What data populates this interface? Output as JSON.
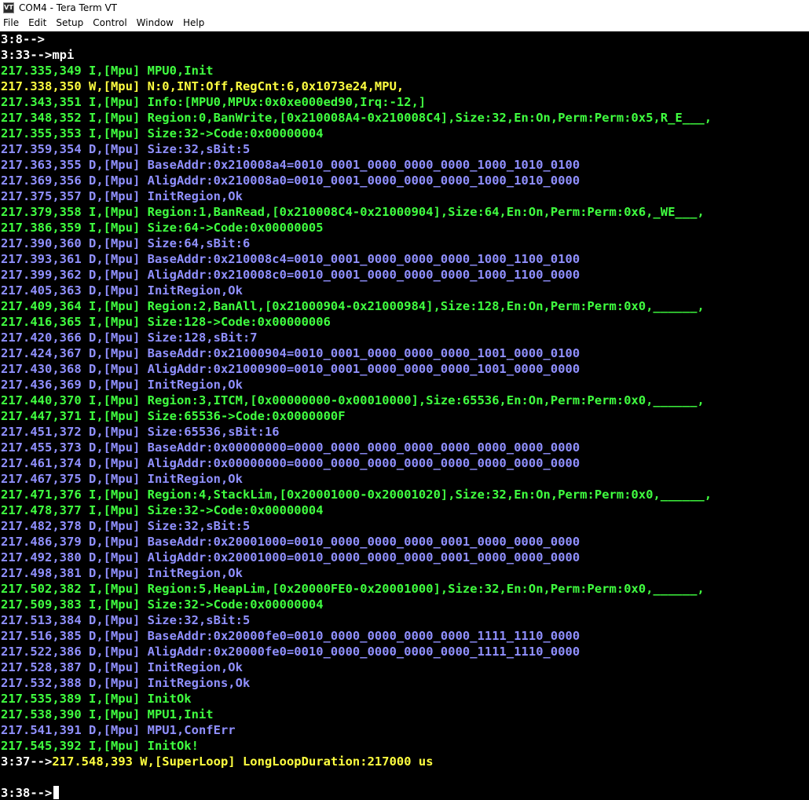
{
  "window": {
    "title": "COM4 - Tera Term VT",
    "icon_text": "VT"
  },
  "menu": {
    "items": [
      "File",
      "Edit",
      "Setup",
      "Control",
      "Window",
      "Help"
    ]
  },
  "colors": {
    "white": "#ffffff",
    "green": "#40ff40",
    "yellow": "#ffff40",
    "blue": "#9090ff"
  },
  "terminal": {
    "lines": [
      [
        {
          "t": "3:8-->",
          "c": "white"
        }
      ],
      [
        {
          "t": "3:33-->mpi",
          "c": "white"
        }
      ],
      [
        {
          "t": "217.335,349 I,[Mpu] MPU0,Init",
          "c": "green"
        }
      ],
      [
        {
          "t": "217.338,350 W,[Mpu] N:0,INT:Off,RegCnt:6,0x1073e24,MPU,",
          "c": "yellow"
        }
      ],
      [
        {
          "t": "217.343,351 I,[Mpu] Info:[MPU0,MPUx:0x0xe000ed90,Irq:-12,]",
          "c": "green"
        }
      ],
      [
        {
          "t": "217.348,352 I,[Mpu] Region:0,BanWrite,[0x210008A4-0x210008C4],Size:32,En:On,Perm:Perm:0x5,R_E___,",
          "c": "green"
        }
      ],
      [
        {
          "t": "217.355,353 I,[Mpu] Size:32->Code:0x00000004",
          "c": "green"
        }
      ],
      [
        {
          "t": "217.359,354 D,[Mpu] Size:32,sBit:5",
          "c": "blue"
        }
      ],
      [
        {
          "t": "217.363,355 D,[Mpu] BaseAddr:0x210008a4=0010_0001_0000_0000_0000_1000_1010_0100",
          "c": "blue"
        }
      ],
      [
        {
          "t": "217.369,356 D,[Mpu] AligAddr:0x210008a0=0010_0001_0000_0000_0000_1000_1010_0000",
          "c": "blue"
        }
      ],
      [
        {
          "t": "217.375,357 D,[Mpu] InitRegion,Ok",
          "c": "blue"
        }
      ],
      [
        {
          "t": "217.379,358 I,[Mpu] Region:1,BanRead,[0x210008C4-0x21000904],Size:64,En:On,Perm:Perm:0x6,_WE___,",
          "c": "green"
        }
      ],
      [
        {
          "t": "217.386,359 I,[Mpu] Size:64->Code:0x00000005",
          "c": "green"
        }
      ],
      [
        {
          "t": "217.390,360 D,[Mpu] Size:64,sBit:6",
          "c": "blue"
        }
      ],
      [
        {
          "t": "217.393,361 D,[Mpu] BaseAddr:0x210008c4=0010_0001_0000_0000_0000_1000_1100_0100",
          "c": "blue"
        }
      ],
      [
        {
          "t": "217.399,362 D,[Mpu] AligAddr:0x210008c0=0010_0001_0000_0000_0000_1000_1100_0000",
          "c": "blue"
        }
      ],
      [
        {
          "t": "217.405,363 D,[Mpu] InitRegion,Ok",
          "c": "blue"
        }
      ],
      [
        {
          "t": "217.409,364 I,[Mpu] Region:2,BanAll,[0x21000904-0x21000984],Size:128,En:On,Perm:Perm:0x0,______,",
          "c": "green"
        }
      ],
      [
        {
          "t": "217.416,365 I,[Mpu] Size:128->Code:0x00000006",
          "c": "green"
        }
      ],
      [
        {
          "t": "217.420,366 D,[Mpu] Size:128,sBit:7",
          "c": "blue"
        }
      ],
      [
        {
          "t": "217.424,367 D,[Mpu] BaseAddr:0x21000904=0010_0001_0000_0000_0000_1001_0000_0100",
          "c": "blue"
        }
      ],
      [
        {
          "t": "217.430,368 D,[Mpu] AligAddr:0x21000900=0010_0001_0000_0000_0000_1001_0000_0000",
          "c": "blue"
        }
      ],
      [
        {
          "t": "217.436,369 D,[Mpu] InitRegion,Ok",
          "c": "blue"
        }
      ],
      [
        {
          "t": "217.440,370 I,[Mpu] Region:3,ITCM,[0x00000000-0x00010000],Size:65536,En:On,Perm:Perm:0x0,______,",
          "c": "green"
        }
      ],
      [
        {
          "t": "217.447,371 I,[Mpu] Size:65536->Code:0x0000000F",
          "c": "green"
        }
      ],
      [
        {
          "t": "217.451,372 D,[Mpu] Size:65536,sBit:16",
          "c": "blue"
        }
      ],
      [
        {
          "t": "217.455,373 D,[Mpu] BaseAddr:0x00000000=0000_0000_0000_0000_0000_0000_0000_0000",
          "c": "blue"
        }
      ],
      [
        {
          "t": "217.461,374 D,[Mpu] AligAddr:0x00000000=0000_0000_0000_0000_0000_0000_0000_0000",
          "c": "blue"
        }
      ],
      [
        {
          "t": "217.467,375 D,[Mpu] InitRegion,Ok",
          "c": "blue"
        }
      ],
      [
        {
          "t": "217.471,376 I,[Mpu] Region:4,StackLim,[0x20001000-0x20001020],Size:32,En:On,Perm:Perm:0x0,______,",
          "c": "green"
        }
      ],
      [
        {
          "t": "217.478,377 I,[Mpu] Size:32->Code:0x00000004",
          "c": "green"
        }
      ],
      [
        {
          "t": "217.482,378 D,[Mpu] Size:32,sBit:5",
          "c": "blue"
        }
      ],
      [
        {
          "t": "217.486,379 D,[Mpu] BaseAddr:0x20001000=0010_0000_0000_0000_0001_0000_0000_0000",
          "c": "blue"
        }
      ],
      [
        {
          "t": "217.492,380 D,[Mpu] AligAddr:0x20001000=0010_0000_0000_0000_0001_0000_0000_0000",
          "c": "blue"
        }
      ],
      [
        {
          "t": "217.498,381 D,[Mpu] InitRegion,Ok",
          "c": "blue"
        }
      ],
      [
        {
          "t": "217.502,382 I,[Mpu] Region:5,HeapLim,[0x20000FE0-0x20001000],Size:32,En:On,Perm:Perm:0x0,______,",
          "c": "green"
        }
      ],
      [
        {
          "t": "217.509,383 I,[Mpu] Size:32->Code:0x00000004",
          "c": "green"
        }
      ],
      [
        {
          "t": "217.513,384 D,[Mpu] Size:32,sBit:5",
          "c": "blue"
        }
      ],
      [
        {
          "t": "217.516,385 D,[Mpu] BaseAddr:0x20000fe0=0010_0000_0000_0000_0000_1111_1110_0000",
          "c": "blue"
        }
      ],
      [
        {
          "t": "217.522,386 D,[Mpu] AligAddr:0x20000fe0=0010_0000_0000_0000_0000_1111_1110_0000",
          "c": "blue"
        }
      ],
      [
        {
          "t": "217.528,387 D,[Mpu] InitRegion,Ok",
          "c": "blue"
        }
      ],
      [
        {
          "t": "217.532,388 D,[Mpu] InitRegions,Ok",
          "c": "blue"
        }
      ],
      [
        {
          "t": "217.535,389 I,[Mpu] InitOk",
          "c": "green"
        }
      ],
      [
        {
          "t": "217.538,390 I,[Mpu] MPU1,Init",
          "c": "green"
        }
      ],
      [
        {
          "t": "217.541,391 D,[Mpu] MPU1,ConfErr",
          "c": "blue"
        }
      ],
      [
        {
          "t": "217.545,392 I,[Mpu] InitOk!",
          "c": "green"
        }
      ],
      [
        {
          "t": "3:37-->",
          "c": "white"
        },
        {
          "t": "217.548,393 W,[SuperLoop] LongLoopDuration:217000 us",
          "c": "yellow"
        }
      ],
      [
        {
          "t": "",
          "c": "white"
        }
      ],
      [
        {
          "t": "3:38-->",
          "c": "white"
        }
      ]
    ]
  }
}
